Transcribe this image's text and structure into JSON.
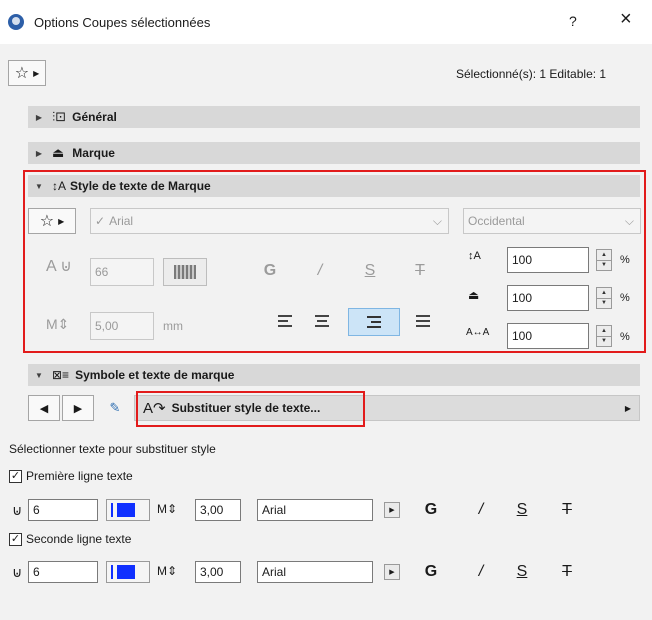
{
  "window": {
    "title": "Options Coupes sélectionnées",
    "help": "?",
    "close": "×"
  },
  "header": {
    "selection_status": "Sélectionné(s): 1 Editable: 1"
  },
  "sections": {
    "general": "Général",
    "marque": "Marque",
    "style_texte": "Style de texte de Marque",
    "symbole": "Symbole et texte de marque"
  },
  "style_panel": {
    "font": "Arial",
    "script": "Occidental",
    "pen": "66",
    "size": "5,00",
    "unit": "mm",
    "bold": "G",
    "italic": "/",
    "underline": "S",
    "strike": "T",
    "line_spacing": "100",
    "char_width": "100",
    "char_spacing": "100",
    "percent": "%"
  },
  "symbol_panel": {
    "substitute_label": "Substituer style de texte...",
    "instruction": "Sélectionner texte pour substituer style",
    "lines": [
      {
        "label": "Première ligne texte",
        "checked": true,
        "pen": "6",
        "size": "3,00",
        "font": "Arial",
        "bold": "G",
        "italic": "/",
        "underline": "S",
        "strike": "T"
      },
      {
        "label": "Seconde ligne texte",
        "checked": true,
        "pen": "6",
        "size": "3,00",
        "font": "Arial",
        "bold": "G",
        "italic": "/",
        "underline": "S",
        "strike": "T"
      }
    ]
  },
  "colors": {
    "accent": "#e21b1b",
    "pen_color": "#1030ff",
    "active_align": "#cce4f7"
  }
}
